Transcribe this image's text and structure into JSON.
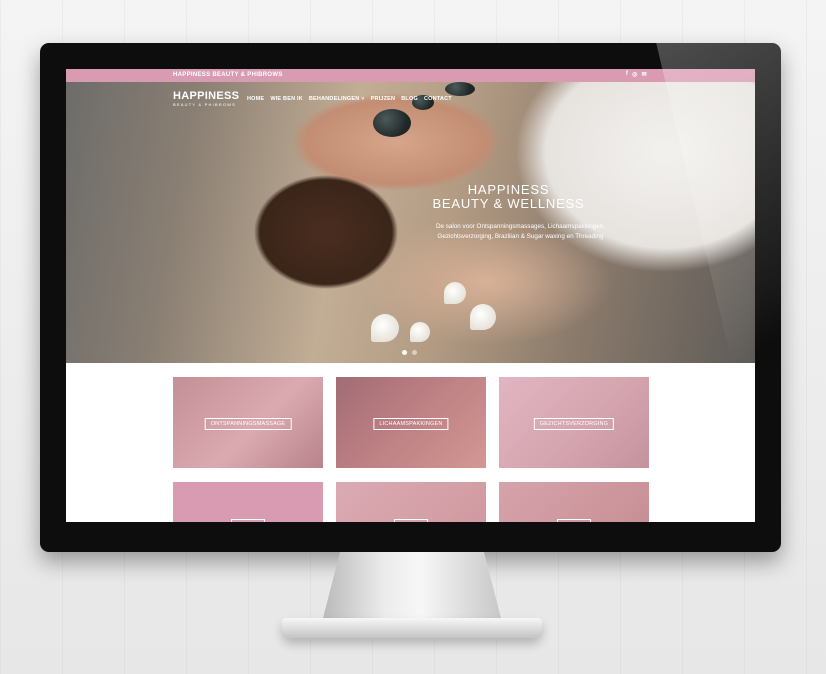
{
  "topbar": {
    "brand": "HAPPINESS BEAUTY & PHIBROWS",
    "social_icons": [
      "facebook-icon",
      "instagram-icon",
      "mail-icon"
    ]
  },
  "logo": {
    "name": "HAPPINESS",
    "tagline": "BEAUTY & PHIBROWS"
  },
  "nav": {
    "items": [
      "HOME",
      "WIE BEN IK",
      "BEHANDELINGEN ˅",
      "PRIJZEN",
      "BLOG",
      "CONTACT"
    ]
  },
  "hero": {
    "title_line1": "HAPPINESS",
    "title_line2": "BEAUTY & WELLNESS",
    "text_line1": "De salon voor Ontspanningsmassages, Lichaamspakkingen,",
    "text_line2": "Gezichtsverzorging, Brazilian & Sugar waxing en Threading",
    "slide_count": 2,
    "active_slide": 1
  },
  "tiles": [
    {
      "label": "ONTSPANNINGSMASSAGE"
    },
    {
      "label": "LICHAAMSPAKKINGEN"
    },
    {
      "label": "GEZICHTSVERZORGING"
    }
  ],
  "colors": {
    "accent": "#d99bb2",
    "bezel": "#0d0d0d"
  }
}
